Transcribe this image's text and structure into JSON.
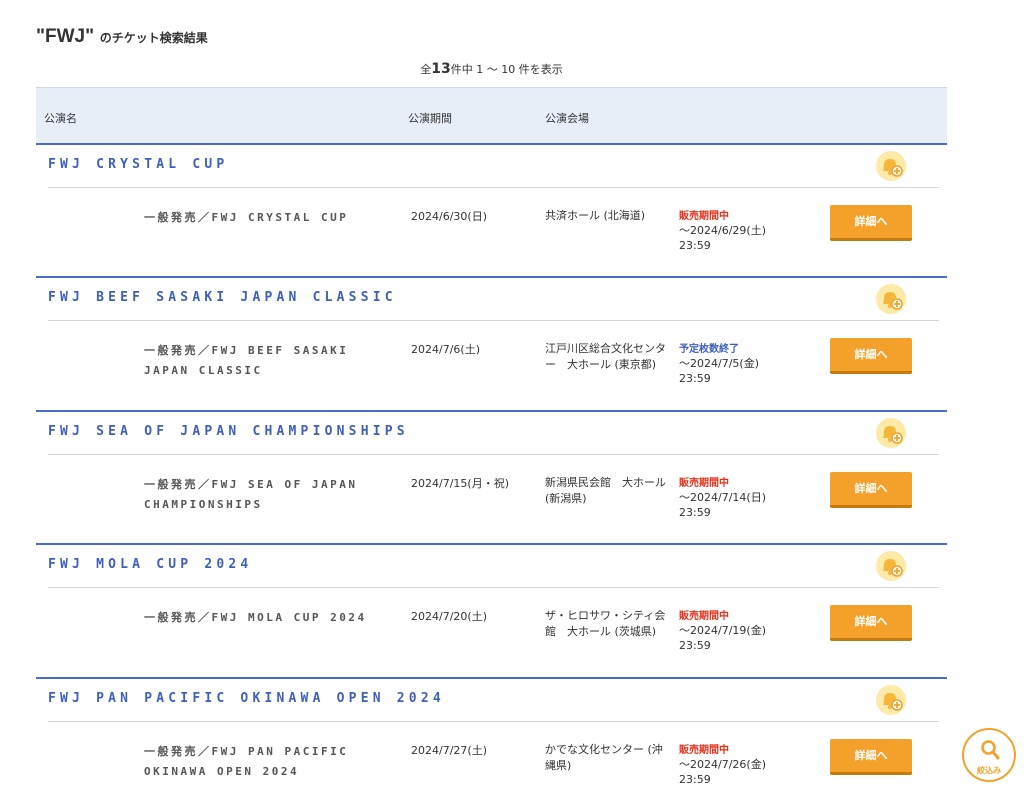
{
  "heading": {
    "query": "\"FWJ\"",
    "suffix": "のチケット検索結果"
  },
  "count": {
    "prefix": "全",
    "total": "13",
    "rest": "件中 1 ～ 10 件を表示"
  },
  "table_header": {
    "name": "公演名",
    "period": "公演期間",
    "venue": "公演会場"
  },
  "events": [
    {
      "title": "FWJ CRYSTAL CUP",
      "sale_name": "一般発売／FWJ CRYSTAL CUP",
      "date": "2024/6/30(日)",
      "venue": "共済ホール (北海道)",
      "status": "販売期間中",
      "deadline": "～2024/6/29(土)",
      "deadline_time": "23:59",
      "detail_label": "詳細へ"
    },
    {
      "title": "FWJ BEEF SASAKI JAPAN CLASSIC",
      "sale_name": "一般発売／FWJ BEEF SASAKI JAPAN CLASSIC",
      "date": "2024/7/6(土)",
      "venue": "江戸川区総合文化センター　大ホール (東京都)",
      "status": "予定枚数終了",
      "deadline": "～2024/7/5(金)",
      "deadline_time": "23:59",
      "detail_label": "詳細へ"
    },
    {
      "title": "FWJ SEA OF JAPAN CHAMPIONSHIPS",
      "sale_name": "一般発売／FWJ SEA OF JAPAN CHAMPIONSHIPS",
      "date": "2024/7/15(月・祝)",
      "venue": "新潟県民会館　大ホール (新潟県)",
      "status": "販売期間中",
      "deadline": "～2024/7/14(日)",
      "deadline_time": "23:59",
      "detail_label": "詳細へ"
    },
    {
      "title": "FWJ MOLA CUP 2024",
      "sale_name": "一般発売／FWJ MOLA CUP 2024",
      "date": "2024/7/20(土)",
      "venue": "ザ・ヒロサワ・シティ会館　大ホール (茨城県)",
      "status": "販売期間中",
      "deadline": "～2024/7/19(金)",
      "deadline_time": "23:59",
      "detail_label": "詳細へ"
    },
    {
      "title": "FWJ PAN PACIFIC OKINAWA OPEN 2024",
      "sale_name": "一般発売／FWJ PAN PACIFIC OKINAWA OPEN 2024",
      "date": "2024/7/27(土)",
      "venue": "かでな文化センター (沖縄県)",
      "status": "販売期間中",
      "deadline": "～2024/7/26(金)",
      "deadline_time": "23:59",
      "detail_label": "詳細へ"
    }
  ],
  "filter": {
    "label": "絞込み",
    "icon": "search-icon"
  },
  "favorite_icon": "bell-plus-icon",
  "colors": {
    "accent": "#3f5fbf",
    "button": "#f3a12a",
    "status_active": "#e5301c",
    "status_soldout": "#3f5fbf"
  }
}
